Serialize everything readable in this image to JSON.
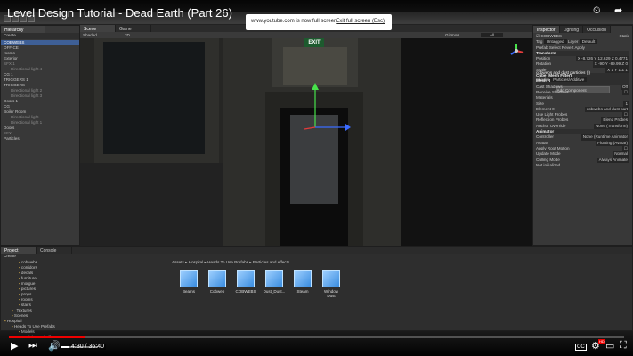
{
  "video": {
    "title": "Level Design Tutorial - Dead Earth (Part 26)",
    "current_time": "4:30",
    "duration": "36:40",
    "progress": 0.123,
    "cc_label": "CC",
    "hd_label": "HD"
  },
  "banner": {
    "message": "www.youtube.com is now full screen.",
    "exit_label": "Exit full screen (Esc)"
  },
  "hierarchy": {
    "tab": "Hierarchy",
    "create": "Create",
    "items": [
      {
        "label": "COBWEBS",
        "level": 0,
        "dim": false,
        "sel": true
      },
      {
        "label": "OFFICE",
        "level": 0,
        "dim": false
      },
      {
        "label": "rooms",
        "level": 0,
        "dim": false
      },
      {
        "label": "Exterior",
        "level": 0,
        "dim": false
      },
      {
        "label": "SFX 1",
        "level": 0,
        "dim": true
      },
      {
        "label": "Directional light 4",
        "level": 1,
        "dim": true
      },
      {
        "label": "CG 1",
        "level": 0,
        "dim": false
      },
      {
        "label": "TRIGGERS 1",
        "level": 0,
        "dim": false
      },
      {
        "label": "TRIGGERS",
        "level": 0,
        "dim": false
      },
      {
        "label": "Directional light 2",
        "level": 1,
        "dim": true
      },
      {
        "label": "Directional light 3",
        "level": 1,
        "dim": true
      },
      {
        "label": "Doors 1",
        "level": 0,
        "dim": false
      },
      {
        "label": "CG",
        "level": 0,
        "dim": false
      },
      {
        "label": "Boiler Room",
        "level": 0,
        "dim": false
      },
      {
        "label": "Directional light",
        "level": 1,
        "dim": true
      },
      {
        "label": "Directional light 1",
        "level": 1,
        "dim": true
      },
      {
        "label": "Doors",
        "level": 0,
        "dim": false
      },
      {
        "label": "SFX",
        "level": 0,
        "dim": true
      },
      {
        "label": "Particles",
        "level": 0,
        "dim": false
      }
    ]
  },
  "scene": {
    "tab": "Scene",
    "game_tab": "Game",
    "shading": "Shaded",
    "mode": "2D",
    "gizmos": "Gizmos",
    "search": "All",
    "exit_sign": "EXIT"
  },
  "project": {
    "tab": "Project",
    "console_tab": "Console",
    "create": "Create",
    "folders": [
      {
        "label": "cobwebs",
        "level": 2
      },
      {
        "label": "corridors",
        "level": 2
      },
      {
        "label": "decals",
        "level": 2
      },
      {
        "label": "furniture",
        "level": 2
      },
      {
        "label": "morgue",
        "level": 2
      },
      {
        "label": "pictures",
        "level": 2
      },
      {
        "label": "props",
        "level": 2
      },
      {
        "label": "rooms",
        "level": 2
      },
      {
        "label": "stairs",
        "level": 2
      },
      {
        "label": "_Textures",
        "level": 1
      },
      {
        "label": "Scenes",
        "level": 1
      },
      {
        "label": "Hospital",
        "level": 0
      },
      {
        "label": "Heads To Use Prefabs",
        "level": 1
      },
      {
        "label": "Models",
        "level": 2
      },
      {
        "label": "Particles and effects",
        "level": 2
      }
    ],
    "breadcrumb": [
      "Assets",
      "Hospital",
      "Heads To Use Prefabs",
      "Particles and effects"
    ],
    "assets": [
      "Beams",
      "Cobweb",
      "COBWEBS",
      "Dust_Dust...",
      "Steam",
      "Window Dust"
    ]
  },
  "inspector": {
    "tab": "Inspector",
    "lighting_tab": "Lighting",
    "occlusion_tab": "Occlusion",
    "object_name": "COBWEBS",
    "static": "Static",
    "tag_label": "Tag",
    "tag": "Untagged",
    "layer_label": "Layer",
    "layer": "Default",
    "prefab_label": "Prefab",
    "prefab_select": "Select",
    "prefab_revert": "Revert",
    "prefab_apply": "Apply",
    "rows": [
      {
        "label": "Transform",
        "value": "",
        "sec": true
      },
      {
        "label": "Position",
        "value": "X -8.726  Y 12.629  Z 0.4771"
      },
      {
        "label": "Rotation",
        "value": "X -90    Y -89.99  Z 0"
      },
      {
        "label": "Scale",
        "value": "X 1      Y 1      Z 1"
      },
      {
        "label": "Cube (Mesh Filter)",
        "value": "",
        "sec": true
      },
      {
        "label": "Mesh Renderer",
        "value": "",
        "sec": true
      },
      {
        "label": "Cast Shadows",
        "value": "Off"
      },
      {
        "label": "Receive Shadows",
        "value": "☐"
      },
      {
        "label": "Materials",
        "value": ""
      },
      {
        "label": "Size",
        "value": "1"
      },
      {
        "label": "Element 0",
        "value": "cobwebs and dust part"
      },
      {
        "label": "Use Light Probes",
        "value": "☐"
      },
      {
        "label": "Reflection Probes",
        "value": "Blend Probes"
      },
      {
        "label": "Anchor Override",
        "value": "None (Transform)"
      },
      {
        "label": "Animator",
        "value": "",
        "sec": true
      },
      {
        "label": "Controller",
        "value": "None (Runtime Animator"
      },
      {
        "label": "Avatar",
        "value": "Floating (Avatar)"
      },
      {
        "label": "Apply Root Motion",
        "value": "☐"
      },
      {
        "label": "Update Mode",
        "value": "Normal"
      },
      {
        "label": "Culling Mode",
        "value": "Always Animate"
      },
      {
        "label": "Not initialized",
        "value": ""
      }
    ],
    "material_name": "cobwebs and dust particles (I)",
    "shader_label": "Shader",
    "shader": "Particles/Additive",
    "add_component": "Add Component"
  },
  "colors": {
    "progress": "#e00000",
    "selection": "#3e5f96",
    "unity_panel": "#383838"
  }
}
